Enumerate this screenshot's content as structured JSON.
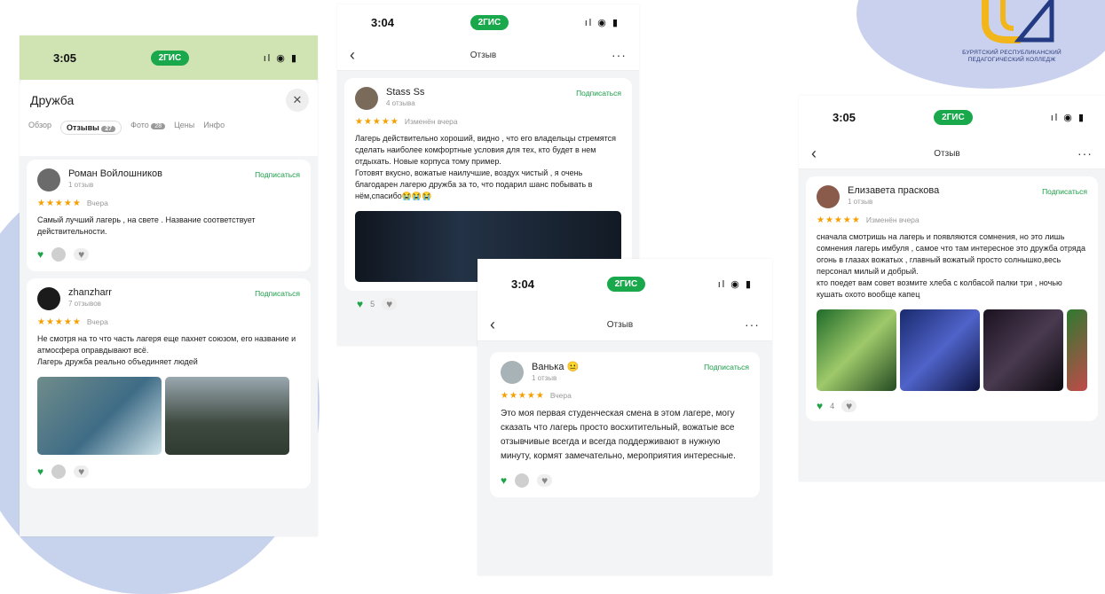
{
  "app": {
    "brand_pill": "2ГИС",
    "status_icons": "ıl ◉ ▮"
  },
  "phones": [
    {
      "time": "3:05",
      "place_title": "Дружба",
      "close": "✕",
      "tabs": [
        {
          "label": "Обзор",
          "active": false
        },
        {
          "label": "Отзывы",
          "badge": "27",
          "active": true
        },
        {
          "label": "Фото",
          "badge": "28",
          "active": false
        },
        {
          "label": "Цены",
          "active": false
        },
        {
          "label": "Инфо",
          "active": false
        }
      ],
      "reviews": [
        {
          "name": "Роман Войлошников",
          "count": "1 отзыв",
          "follow": "Подписаться",
          "date": "Вчера",
          "text": "Самый лучший лагерь , на свете . Название соответствует действительности."
        },
        {
          "name": "zhanzharr",
          "count": "7 отзывов",
          "follow": "Подписаться",
          "date": "Вчера",
          "text": "Не смотря на то что часть лагеря еще пахнет союзом, его название и атмосфера оправдывают всё.\nЛагерь дружба реально объединяет людей"
        }
      ]
    },
    {
      "time": "3:04",
      "nav_title": "Отзыв",
      "review": {
        "name": "Stass Ss",
        "count": "4 отзыва",
        "follow": "Подписаться",
        "date": "Изменён вчера",
        "text": "Лагерь действительно хороший, видно , что его владельцы стремятся сделать наиболее комфортные условия для тех, кто будет в нем отдыхать. Новые корпуса тому пример.\nГотовят вкусно, вожатые наилучшие, воздух чистый , я очень благодарен лагерю дружба за то, что подарил шанс побывать в нём,спасибо😭😭😭",
        "likes": "5"
      }
    },
    {
      "time": "3:04",
      "nav_title": "Отзыв",
      "review": {
        "name": "Ванька 😐",
        "count": "1 отзыв",
        "follow": "Подписаться",
        "date": "Вчера",
        "text": "Это моя первая студенческая смена в этом лагере, могу сказать что лагерь просто восхитительный, вожатые все отзывчивые всегда и всегда поддерживают в нужную минуту, кормят замечательно, мероприятия интересные."
      }
    },
    {
      "time": "3:05",
      "nav_title": "Отзыв",
      "review": {
        "name": "Елизавета праскова",
        "count": "1 отзыв",
        "follow": "Подписаться",
        "date": "Изменён вчера",
        "text": "сначала смотришь на лагерь и появляются сомнения, но это лишь сомнения лагерь имбуля , самое что там интересное это дружба отряда огонь в глазах вожатых , главный вожатый просто солнышко,весь персонал милый и добрый.\n кто поедет вам совет возмите хлеба с колбасой палки три , ночью кушать охото вообще капец",
        "likes": "4"
      }
    }
  ],
  "logo": {
    "caption_line1": "Бурятский республиканский",
    "caption_line2": "педагогический колледж"
  },
  "colors": {
    "green": "#1a9e47",
    "star": "#f5a000",
    "blob": "#c7d2ec"
  }
}
